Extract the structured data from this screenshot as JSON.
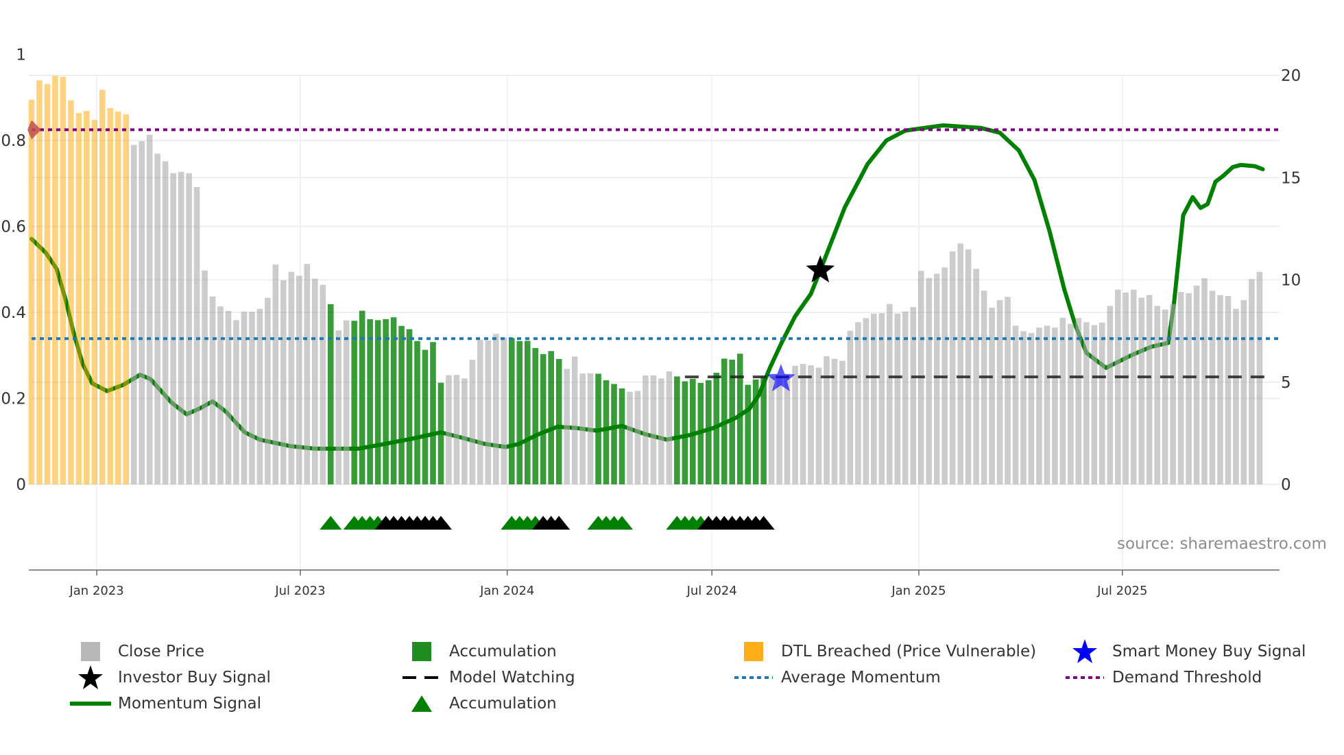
{
  "chart_data": {
    "type": "bar",
    "start_date": "2022-11-04",
    "interval_days": 7,
    "x_ticks": [
      {
        "label": "Jan 2023",
        "date": "2023-01-01"
      },
      {
        "label": "Jul 2023",
        "date": "2023-07-01"
      },
      {
        "label": "Jan 2024",
        "date": "2024-01-01"
      },
      {
        "label": "Jul 2024",
        "date": "2024-07-01"
      },
      {
        "label": "Jan 2025",
        "date": "2025-01-01"
      },
      {
        "label": "Jul 2025",
        "date": "2025-07-01"
      }
    ],
    "y_left": {
      "range": [
        0,
        1
      ],
      "ticks": [
        0,
        0.2,
        0.4,
        0.6,
        0.8,
        1
      ],
      "tick_labels": [
        "0",
        "0.2",
        "0.4",
        "0.6",
        "0.8",
        "1"
      ]
    },
    "y_right": {
      "range": [
        0,
        20
      ],
      "ticks": [
        0,
        5,
        10,
        15,
        20
      ],
      "tick_labels": [
        "0",
        "5",
        "10",
        "15",
        "20"
      ]
    },
    "close_price": [
      18.81,
      19.76,
      19.58,
      19.98,
      19.93,
      18.78,
      18.16,
      18.26,
      17.82,
      19.29,
      18.4,
      18.23,
      18.09,
      16.6,
      16.78,
      17.1,
      16.17,
      15.8,
      15.22,
      15.28,
      15.21,
      14.54,
      10.46,
      9.19,
      8.7,
      8.48,
      8.03,
      8.45,
      8.44,
      8.58,
      9.12,
      10.75,
      9.98,
      10.39,
      10.2,
      10.78,
      10.06,
      9.76,
      8.81,
      7.53,
      8.02,
      8.0,
      8.49,
      8.08,
      8.03,
      8.08,
      8.17,
      7.75,
      7.59,
      7.01,
      6.58,
      6.96,
      4.97,
      5.34,
      5.35,
      5.18,
      6.09,
      7.07,
      7.04,
      7.36,
      7.18,
      7.16,
      7.01,
      7.02,
      6.67,
      6.37,
      6.52,
      6.13,
      5.65,
      6.25,
      5.42,
      5.43,
      5.41,
      5.09,
      4.91,
      4.69,
      4.53,
      4.57,
      5.33,
      5.33,
      5.18,
      5.53,
      5.28,
      5.04,
      5.16,
      4.96,
      5.09,
      5.46,
      6.15,
      6.1,
      6.39,
      4.87,
      5.13,
      5.26,
      5.26,
      5.22,
      5.18,
      5.8,
      5.89,
      5.82,
      5.71,
      6.27,
      6.14,
      6.04,
      7.51,
      7.93,
      8.13,
      8.35,
      8.37,
      8.82,
      8.35,
      8.45,
      8.67,
      10.44,
      10.09,
      10.3,
      10.61,
      11.39,
      11.78,
      11.49,
      10.54,
      9.47,
      8.64,
      9.01,
      9.17,
      7.76,
      7.49,
      7.4,
      7.67,
      7.76,
      7.67,
      8.15,
      7.85,
      8.13,
      7.93,
      7.79,
      7.91,
      8.73,
      9.52,
      9.38,
      9.52,
      9.13,
      9.26,
      8.73,
      8.55,
      8.82,
      9.41,
      9.35,
      9.72,
      10.08,
      9.47,
      9.26,
      9.21,
      8.58,
      9.01,
      10.04,
      10.39
    ],
    "dtl_breached_ranges": [
      [
        0,
        12
      ]
    ],
    "accumulation_ranges": [
      [
        38,
        38
      ],
      [
        41,
        52
      ],
      [
        61,
        67
      ],
      [
        72,
        75
      ],
      [
        82,
        93
      ]
    ],
    "momentum_signal": [
      [
        0,
        0.571
      ],
      [
        1.8,
        0.539
      ],
      [
        3.2,
        0.501
      ],
      [
        4.4,
        0.425
      ],
      [
        5.3,
        0.356
      ],
      [
        6.5,
        0.28
      ],
      [
        7.7,
        0.235
      ],
      [
        9.6,
        0.217
      ],
      [
        11.6,
        0.231
      ],
      [
        13.8,
        0.255
      ],
      [
        15.1,
        0.245
      ],
      [
        17.8,
        0.19
      ],
      [
        19.7,
        0.163
      ],
      [
        21.3,
        0.176
      ],
      [
        23,
        0.193
      ],
      [
        24.7,
        0.169
      ],
      [
        27.1,
        0.121
      ],
      [
        29,
        0.104
      ],
      [
        32.9,
        0.089
      ],
      [
        36,
        0.083
      ],
      [
        41.5,
        0.083
      ],
      [
        44.6,
        0.093
      ],
      [
        48.5,
        0.107
      ],
      [
        52,
        0.121
      ],
      [
        54.6,
        0.109
      ],
      [
        57.6,
        0.094
      ],
      [
        60.2,
        0.087
      ],
      [
        61.9,
        0.094
      ],
      [
        64.2,
        0.115
      ],
      [
        66.8,
        0.134
      ],
      [
        69.2,
        0.131
      ],
      [
        71.8,
        0.125
      ],
      [
        75,
        0.136
      ],
      [
        77.9,
        0.117
      ],
      [
        80.7,
        0.104
      ],
      [
        83.7,
        0.115
      ],
      [
        86.6,
        0.131
      ],
      [
        89.5,
        0.155
      ],
      [
        91.2,
        0.176
      ],
      [
        92.4,
        0.208
      ],
      [
        93.8,
        0.271
      ],
      [
        95.3,
        0.33
      ],
      [
        97,
        0.391
      ],
      [
        99,
        0.443
      ],
      [
        100.2,
        0.498
      ],
      [
        103.3,
        0.644
      ],
      [
        106.2,
        0.745
      ],
      [
        108.6,
        0.8
      ],
      [
        111,
        0.823
      ],
      [
        115.8,
        0.835
      ],
      [
        120.6,
        0.829
      ],
      [
        123,
        0.818
      ],
      [
        125.4,
        0.777
      ],
      [
        127.4,
        0.708
      ],
      [
        129.3,
        0.59
      ],
      [
        131.2,
        0.453
      ],
      [
        132.6,
        0.37
      ],
      [
        134,
        0.306
      ],
      [
        136.5,
        0.271
      ],
      [
        139.8,
        0.301
      ],
      [
        142.2,
        0.32
      ],
      [
        144.4,
        0.329
      ],
      [
        145.1,
        0.416
      ],
      [
        146.3,
        0.626
      ],
      [
        147.5,
        0.668
      ],
      [
        148.5,
        0.643
      ],
      [
        149.4,
        0.652
      ],
      [
        150.4,
        0.704
      ],
      [
        151.4,
        0.718
      ],
      [
        152.6,
        0.738
      ],
      [
        153.6,
        0.743
      ],
      [
        155.4,
        0.74
      ],
      [
        156.4,
        0.733
      ]
    ],
    "average_momentum": 0.339,
    "demand_threshold": 0.825,
    "model_watching": {
      "value": 0.25,
      "from_week": 83
    },
    "dtl_marker": {
      "week": 0,
      "value": 0.825
    },
    "investor_buy_signal": [
      {
        "week": 100.2,
        "value": 0.498
      }
    ],
    "smart_money_buy_signal": [
      {
        "week": 95.2,
        "value": 0.245
      }
    ],
    "accumulation_triangles_green": [
      38,
      41,
      42,
      43,
      44,
      61,
      62,
      63,
      64,
      72,
      73,
      74,
      75,
      82,
      83,
      84,
      85
    ],
    "accumulation_triangles_black": [
      45,
      46,
      47,
      48,
      49,
      50,
      51,
      52,
      65,
      66,
      67,
      86,
      87,
      88,
      89,
      90,
      91,
      92,
      93
    ],
    "source": "source: sharemaestro.com",
    "legend": [
      {
        "label": "Close Price",
        "symbol": "square",
        "color": "#b8b8b8"
      },
      {
        "label": "Investor Buy Signal",
        "symbol": "star",
        "color": "#000000"
      },
      {
        "label": "Momentum Signal",
        "symbol": "line",
        "color": "#008000"
      },
      {
        "label": "Accumulation",
        "symbol": "square",
        "color": "#1e8c1e"
      },
      {
        "label": "Model Watching",
        "symbol": "dash",
        "color": "#000000"
      },
      {
        "label": "Accumulation",
        "symbol": "triangle",
        "color": "#008000"
      },
      {
        "label": "DTL Breached (Price Vulnerable)",
        "symbol": "square",
        "color": "#ffae1a"
      },
      {
        "label": "Average Momentum",
        "symbol": "dot",
        "color": "#1f77b4"
      },
      {
        "label": "Smart Money Buy Signal",
        "symbol": "star",
        "color": "#0000ff"
      },
      {
        "label": "Demand Threshold",
        "symbol": "dot",
        "color": "#800080"
      }
    ],
    "colors": {
      "gray": "#c8c8c8",
      "green_bar": "#389c38",
      "orange_bar": "#ffd280",
      "momentum": "#008000",
      "avg": "#1f77b4",
      "demand": "#800080",
      "dtl_marker": "#c0504d"
    }
  }
}
